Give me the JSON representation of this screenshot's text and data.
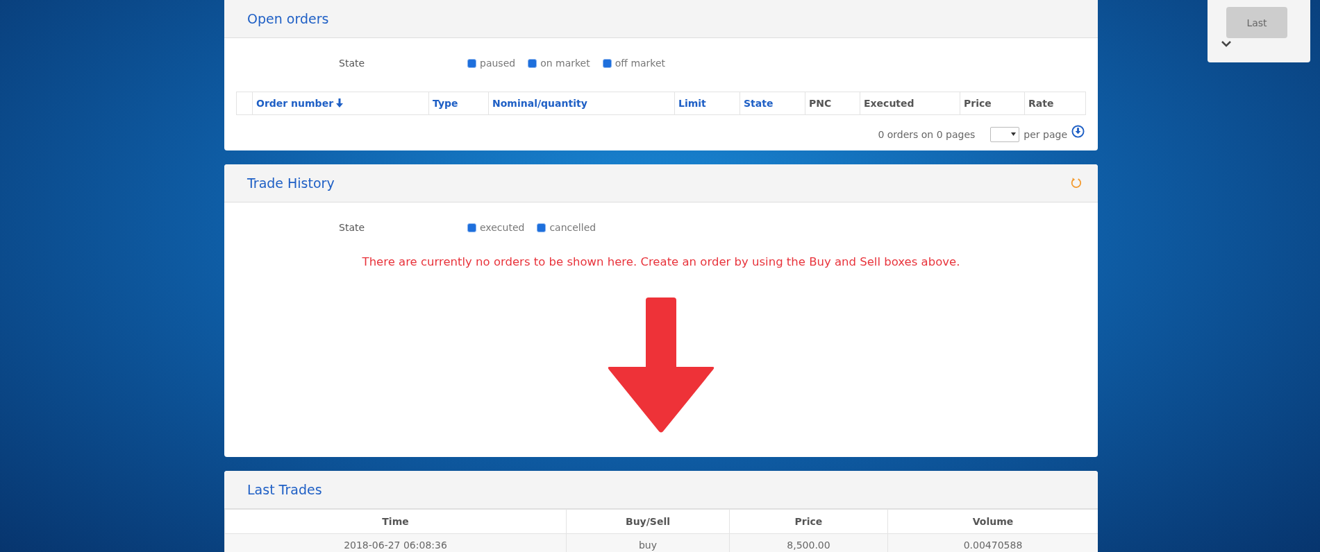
{
  "open_orders": {
    "title": "Open orders",
    "filter": {
      "label": "State",
      "options": [
        {
          "label": "paused",
          "checked": true
        },
        {
          "label": "on market",
          "checked": true
        },
        {
          "label": "off market",
          "checked": true
        }
      ]
    },
    "table": {
      "columns": [
        {
          "label": "Order number",
          "sortable": true,
          "sorted": true
        },
        {
          "label": "Type",
          "sortable": true,
          "sorted": false
        },
        {
          "label": "Nominal/quantity",
          "sortable": true,
          "sorted": false
        },
        {
          "label": "Limit",
          "sortable": true,
          "sorted": false
        },
        {
          "label": "State",
          "sortable": true,
          "sorted": false
        },
        {
          "label": "PNC",
          "sortable": false,
          "sorted": false
        },
        {
          "label": "Executed",
          "sortable": false,
          "sorted": false
        },
        {
          "label": "Price",
          "sortable": false,
          "sorted": false
        },
        {
          "label": "Rate",
          "sortable": false,
          "sorted": false
        }
      ]
    },
    "pagination": {
      "summary": "0 orders on 0 pages",
      "per_page_label": "per page"
    }
  },
  "trade_history": {
    "title": "Trade History",
    "filter": {
      "label": "State",
      "options": [
        {
          "label": "executed",
          "checked": true
        },
        {
          "label": "cancelled",
          "checked": true
        }
      ]
    },
    "message": "There are currently no orders to be shown here. Create an order by using the Buy and Sell boxes above."
  },
  "last_trades": {
    "title": "Last Trades",
    "columns": [
      "Time",
      "Buy/Sell",
      "Price",
      "Volume"
    ],
    "rows": [
      [
        "2018-06-27 06:08:36",
        "buy",
        "8,500.00",
        "0.00470588"
      ]
    ]
  },
  "side_widget": {
    "button": "Last"
  }
}
